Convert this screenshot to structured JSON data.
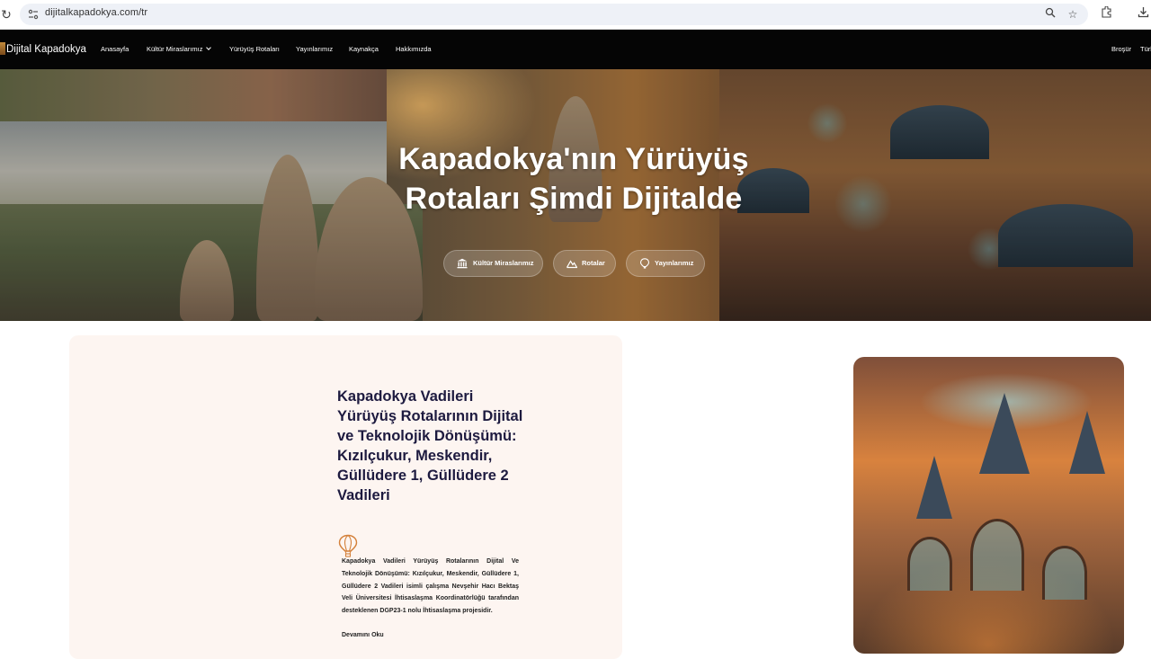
{
  "browser": {
    "url": "dijitalkapadokya.com/tr",
    "reload_icon": "reload-icon",
    "icons": [
      "site-info-icon",
      "zoom-icon",
      "star-icon",
      "extensions-icon",
      "download-icon"
    ]
  },
  "nav": {
    "logo": "Dijital Kapadokya",
    "items": [
      "Anasayfa",
      "Kültür Miraslarımız",
      "Yürüyüş Rotaları",
      "Yayınlarımız",
      "Kaynakça",
      "Hakkımızda"
    ],
    "right": [
      "Broşür",
      "Türk"
    ]
  },
  "hero": {
    "title": "Kapadokya'nın Yürüyüş Rotaları Şimdi Dijitalde",
    "buttons": [
      {
        "label": "Kültür Miraslarımız",
        "icon": "museum-icon"
      },
      {
        "label": "Rotalar",
        "icon": "mountain-icon"
      },
      {
        "label": "Yayınlarımız",
        "icon": "balloon-icon"
      }
    ]
  },
  "card": {
    "title": "Kapadokya Vadileri Yürüyüş Rotalarının Dijital ve Teknolojik Dönüşümü: Kızılçukur, Meskendir, Güllüdere 1, Güllüdere 2 Vadileri",
    "text": "Kapadokya Vadileri Yürüyüş Rotalarının Dijital Ve Teknolojik Dönüşümü: Kızılçukur, Meskendir, Güllüdere 1, Güllüdere 2 Vadileri isimli çalışma Nevşehir Hacı Bektaş Veli Üniversitesi İhtisaslaşma Koordinatörlüğü tarafından desteklenen DGP23-1 nolu İhtisaslaşma projesidir.",
    "read_more": "Devamını Oku"
  },
  "colors": {
    "nav_bg": "#050505",
    "card_bg": "#fdf5f1",
    "title_color": "#1d1a3f",
    "accent": "#d4803a"
  }
}
